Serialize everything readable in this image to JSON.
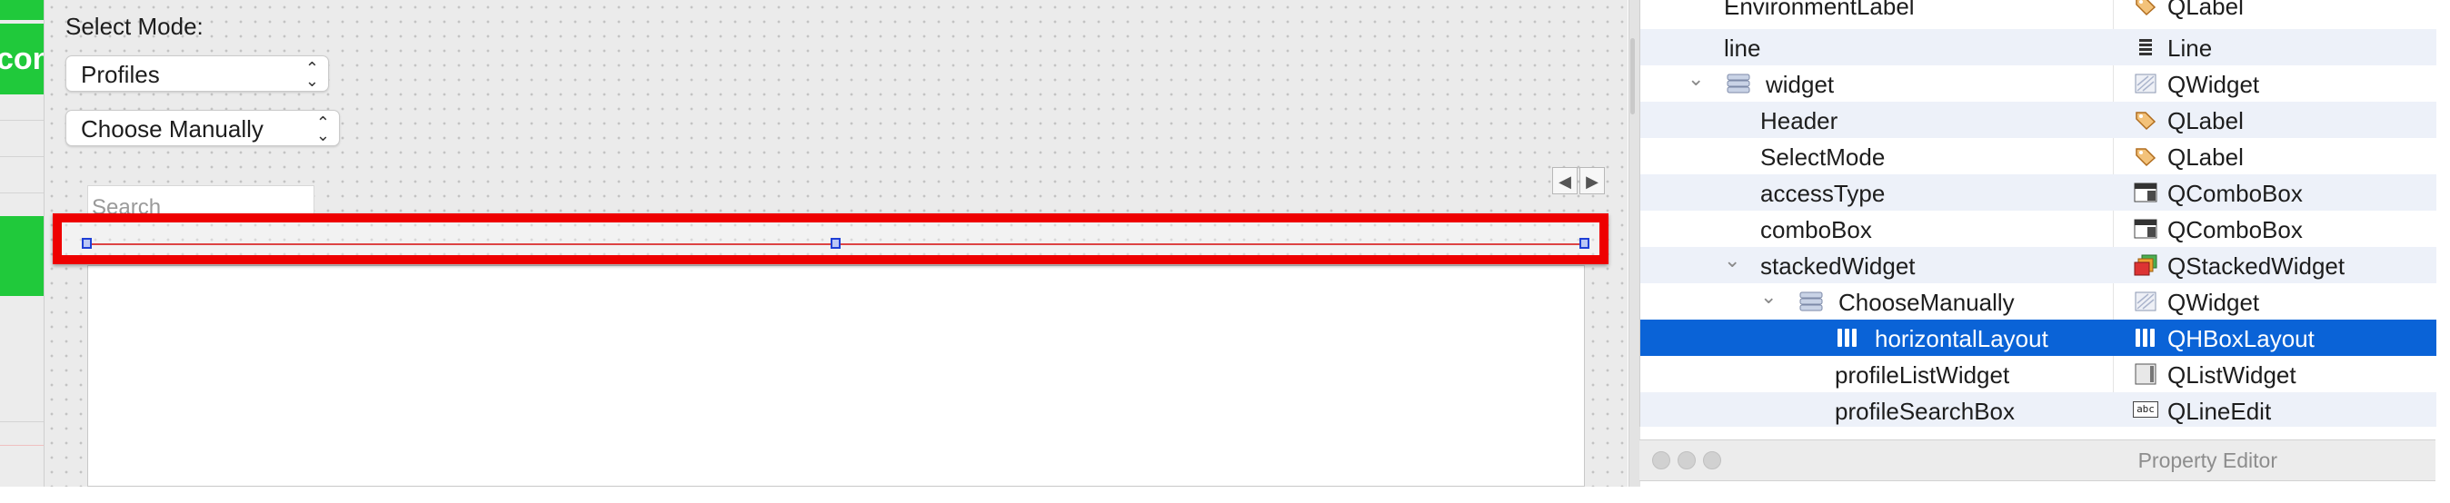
{
  "left_strip": {
    "button_top_label": "con"
  },
  "form": {
    "select_mode_label": "Select Mode:",
    "mode_combo_value": "Profiles",
    "access_combo_value": "Choose Manually",
    "search_placeholder": "Search",
    "nav_prev": "◀",
    "nav_next": "▶",
    "combo_arrows_up": "⌃",
    "combo_arrows_down": "⌄"
  },
  "inspector": {
    "rows": [
      {
        "name": "EnvironmentLabel",
        "class": "QLabel",
        "icon": "label-tag-icon"
      },
      {
        "name": "line",
        "class": "Line",
        "icon": "line-icon"
      },
      {
        "name": "widget",
        "class": "QWidget",
        "icon": "widget-icon",
        "expanded": true
      },
      {
        "name": "Header",
        "class": "QLabel",
        "icon": "label-tag-icon"
      },
      {
        "name": "SelectMode",
        "class": "QLabel",
        "icon": "label-tag-icon"
      },
      {
        "name": "accessType",
        "class": "QComboBox",
        "icon": "combobox-icon"
      },
      {
        "name": "comboBox",
        "class": "QComboBox",
        "icon": "combobox-icon"
      },
      {
        "name": "stackedWidget",
        "class": "QStackedWidget",
        "icon": "stacked-widget-icon",
        "expanded": true
      },
      {
        "name": "ChooseManually",
        "class": "QWidget",
        "icon": "widget-icon",
        "expanded": true
      },
      {
        "name": "horizontalLayout",
        "class": "QHBoxLayout",
        "icon": "hbox-layout-icon",
        "selected": true
      },
      {
        "name": "profileListWidget",
        "class": "QListWidget",
        "icon": "list-widget-icon"
      },
      {
        "name": "profileSearchBox",
        "class": "QLineEdit",
        "icon": "line-edit-icon"
      }
    ],
    "chevron_glyph": "⌄",
    "line_edit_icon_text": "abc"
  },
  "property_editor": {
    "title": "Property Editor"
  },
  "colors": {
    "selection": "#0a63d7",
    "highlight_box": "#ee0000",
    "green_button": "#20c93b"
  }
}
